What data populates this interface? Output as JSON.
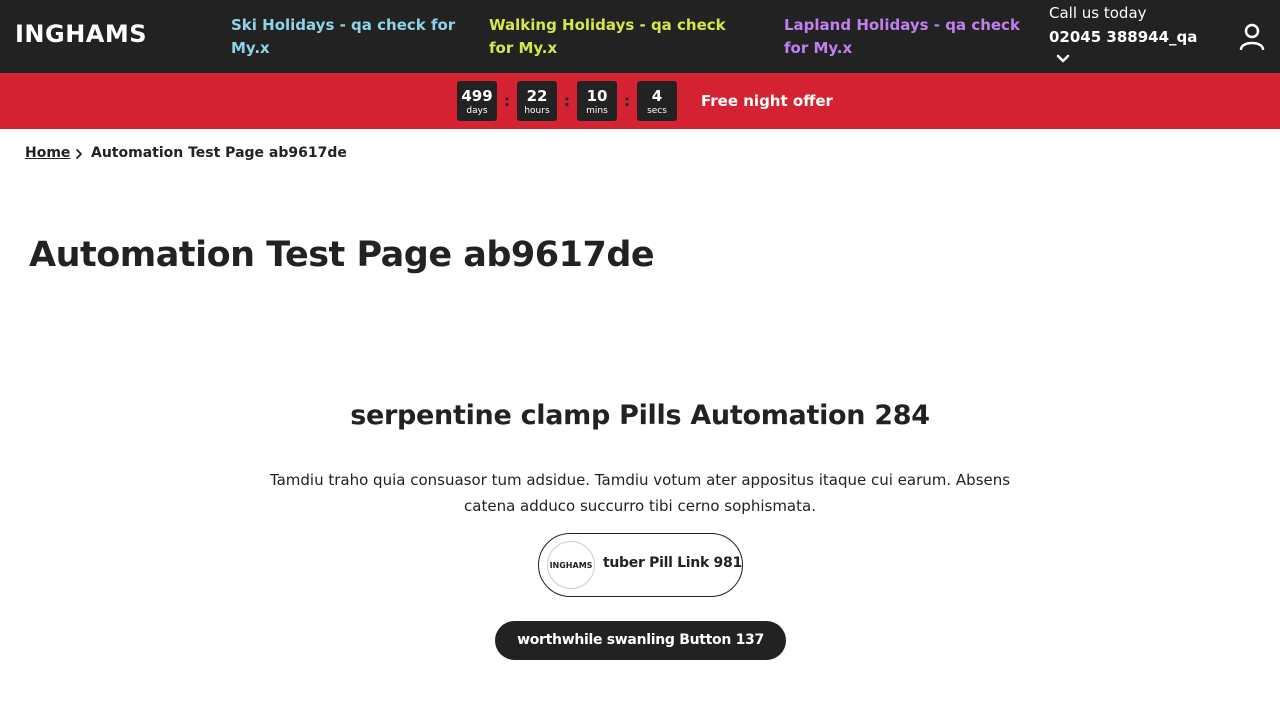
{
  "header": {
    "logo": "INGHAMS",
    "nav": [
      {
        "label": "Ski Holidays - qa check for My.x",
        "color": "#8fd3e8"
      },
      {
        "label": "Walking Holidays - qa check for My.x",
        "color": "#d4e84a"
      },
      {
        "label": "Lapland Holidays - qa check for My.x",
        "color": "#c17ff0"
      }
    ],
    "call_label": "Call us today",
    "phone": "02045 388944_qa",
    "icons": {
      "dropdown": "chevron-down-icon",
      "account": "user-icon"
    }
  },
  "countdown": {
    "days": {
      "value": "499",
      "label": "days"
    },
    "hours": {
      "value": "22",
      "label": "hours"
    },
    "mins": {
      "value": "10",
      "label": "mins"
    },
    "secs": {
      "value": "4",
      "label": "secs"
    },
    "separator": ":",
    "offer": "Free night offer",
    "band_color": "#d52233"
  },
  "breadcrumb": {
    "home": "Home",
    "current": "Automation Test Page ab9617de"
  },
  "page": {
    "title": "Automation Test Page ab9617de"
  },
  "section": {
    "heading": "serpentine clamp Pills Automation 284",
    "body": "Tamdiu traho quia consuasor tum adsidue. Tamdiu votum ater appositus itaque cui earum. Absens catena adduco succurro tibi cerno sophismata.",
    "pill": {
      "avatar_text": "INGHAMS",
      "label": "tuber Pill Link 981"
    },
    "button": "worthwhile swanling Button 137"
  }
}
